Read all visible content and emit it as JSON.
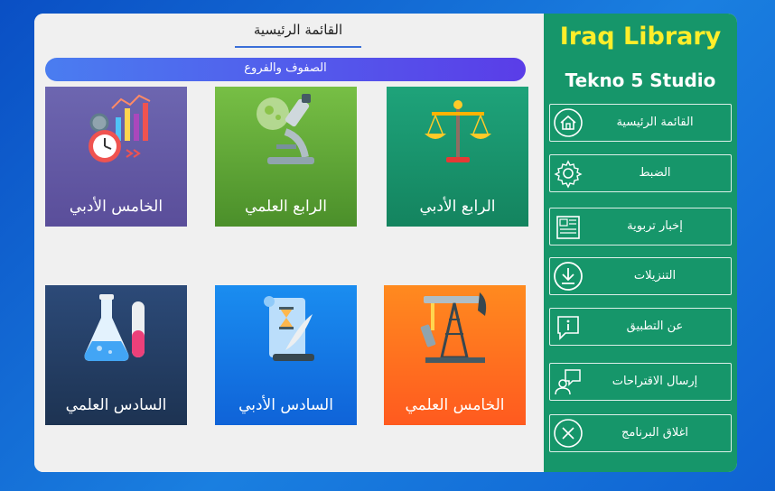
{
  "main": {
    "title": "القائمة الرئيسية",
    "section_label": "الصفوف والفروع",
    "tiles": [
      {
        "label": "الخامس الأدبي",
        "icon": "analytics-clock-icon"
      },
      {
        "label": "الرابع العلمي",
        "icon": "microscope-icon"
      },
      {
        "label": "الرابع الأدبي",
        "icon": "scales-icon"
      },
      {
        "label": "السادس العلمي",
        "icon": "lab-flasks-icon"
      },
      {
        "label": "السادس الأدبي",
        "icon": "scroll-quill-icon"
      },
      {
        "label": "الخامس العلمي",
        "icon": "oil-pump-icon"
      }
    ]
  },
  "sidebar": {
    "brand": "Iraq Library",
    "studio": "Tekno 5 Studio",
    "items": [
      {
        "label": "القائمة الرئيسية",
        "icon": "home-icon"
      },
      {
        "label": "الضبط",
        "icon": "gear-icon"
      },
      {
        "label": "إخبار تربوية",
        "icon": "newspaper-icon"
      },
      {
        "label": "التنزيلات",
        "icon": "download-icon"
      },
      {
        "label": "عن التطبيق",
        "icon": "info-chat-icon"
      },
      {
        "label": "إرسال الاقتراحات",
        "icon": "feedback-icon"
      },
      {
        "label": "اغلاق البرنامج",
        "icon": "close-circle-icon"
      }
    ]
  },
  "colors": {
    "sidebar_bg": "#16966a",
    "brand_text": "#ffee2a",
    "section_bar": "#4a7df0"
  }
}
